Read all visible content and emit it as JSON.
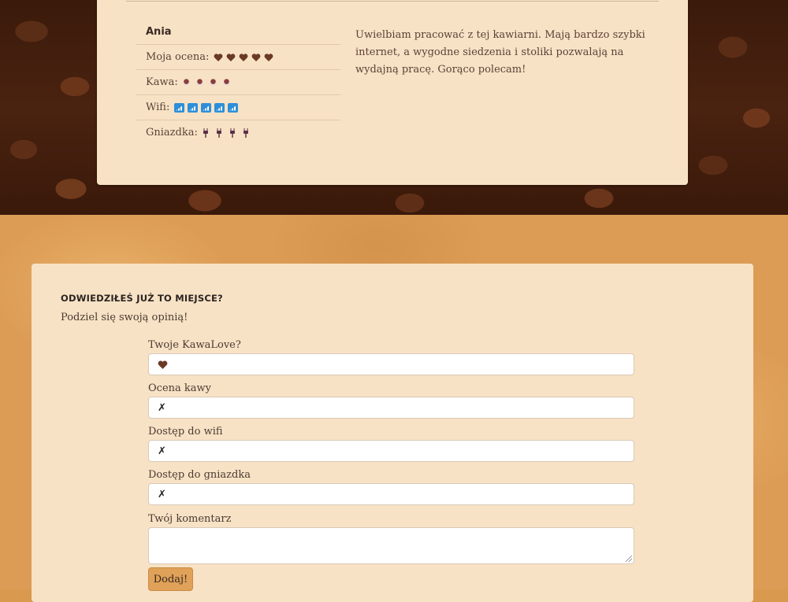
{
  "review": {
    "author": "Ania",
    "ratings": [
      {
        "label": "Moja ocena:",
        "icon": "heart-icon",
        "count": 5
      },
      {
        "label": "Kawa:",
        "icon": "coffee-bean-icon",
        "count": 4
      },
      {
        "label": "Wifi:",
        "icon": "wifi-signal-icon",
        "count": 5
      },
      {
        "label": "Gniazdka:",
        "icon": "plug-icon",
        "count": 4
      }
    ],
    "text": "Uwielbiam pracować z tej kawiarni. Mają bardzo szybki internet, a wygodne siedzenia i stoliki pozwalają na wydajną pracę. Gorąco polecam!"
  },
  "form": {
    "title": "ODWIEDZIŁEŚ JUŻ TO MIEJSCE?",
    "subtitle": "Podziel się swoją opinią!",
    "fields": {
      "kawalove": {
        "label": "Twoje KawaLove?",
        "value_icon": "heart-icon"
      },
      "coffee": {
        "label": "Ocena kawy",
        "value": "✗"
      },
      "wifi": {
        "label": "Dostęp do wifi",
        "value": "✗"
      },
      "socket": {
        "label": "Dostęp do gniazdka",
        "value": "✗"
      },
      "comment": {
        "label": "Twój komentarz",
        "value": ""
      }
    },
    "submit_label": "Dodaj!"
  },
  "colors": {
    "card_bg": "#f8e2c5",
    "heart": "#6b3a24",
    "bean": "#8a3e3a",
    "wifi": "#2e8fd8",
    "plug": "#5a3046",
    "button": "#e0a159"
  }
}
